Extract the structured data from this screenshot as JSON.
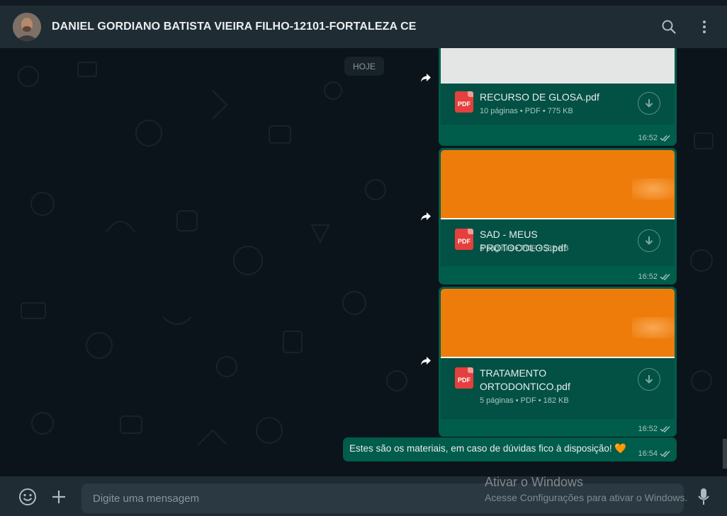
{
  "header": {
    "contact_name": "DANIEL GORDIANO BATISTA VIEIRA FILHO-12101-FORTALEZA CE",
    "icons": [
      "search-icon",
      "menu-icon"
    ]
  },
  "chat": {
    "day_label": "HOJE",
    "documents": [
      {
        "file_name": "RECURSO DE GLOSA.pdf",
        "meta": "10 páginas • PDF • 775 KB",
        "time": "16:52",
        "icon_label": "PDF"
      },
      {
        "file_name": "SAD - MEUS PROTOCOLOS.pdf",
        "meta": "6 páginas • PDF • 582 KB",
        "time": "16:52",
        "icon_label": "PDF"
      },
      {
        "file_name": "TRATAMENTO ORTODONTICO.pdf",
        "meta": "5 páginas • PDF • 182 KB",
        "time": "16:52",
        "icon_label": "PDF"
      }
    ],
    "text_message": {
      "text": "Estes são os materiais, em caso de dúvidas fico à disposição! 🧡",
      "time": "16:54"
    }
  },
  "compose": {
    "placeholder": "Digite uma mensagem"
  },
  "watermark": {
    "line1": "Ativar o Windows",
    "line2": "Acesse Configurações para ativar o Windows."
  },
  "colors": {
    "outgoing_bubble": "#005c4b",
    "header_bg": "#202c33",
    "chat_bg": "#0b141a",
    "preview_orange": "#ee7c0b"
  }
}
